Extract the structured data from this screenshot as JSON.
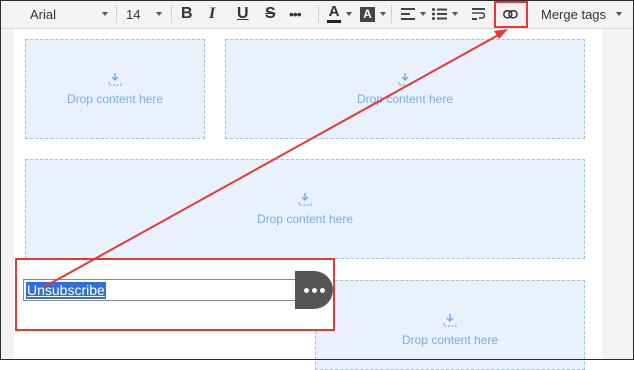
{
  "toolbar": {
    "font_family": "Arial",
    "font_size": "14",
    "bold_label": "B",
    "italic_label": "I",
    "underline_label": "U",
    "strike_label": "S",
    "more_label": "•••",
    "text_color_label": "A",
    "bg_color_label": "A",
    "merge_tags_label": "Merge tags",
    "icons": [
      "align-left-icon",
      "bulleted-list-icon",
      "paragraph-format-icon",
      "link-icon"
    ]
  },
  "drop_zones": [
    {
      "label": "Drop content here"
    },
    {
      "label": "Drop content here"
    },
    {
      "label": "Drop content here"
    },
    {
      "label": "Drop content here"
    }
  ],
  "link_editor": {
    "selected_text": "Unsubscribe",
    "more_button_icon": "ellipsis-icon"
  },
  "colors": {
    "highlight": "#e53935",
    "drop_zone_bg": "#e9f1fc",
    "drop_zone_text": "#7aaee0",
    "selection": "#2f6fd8"
  }
}
